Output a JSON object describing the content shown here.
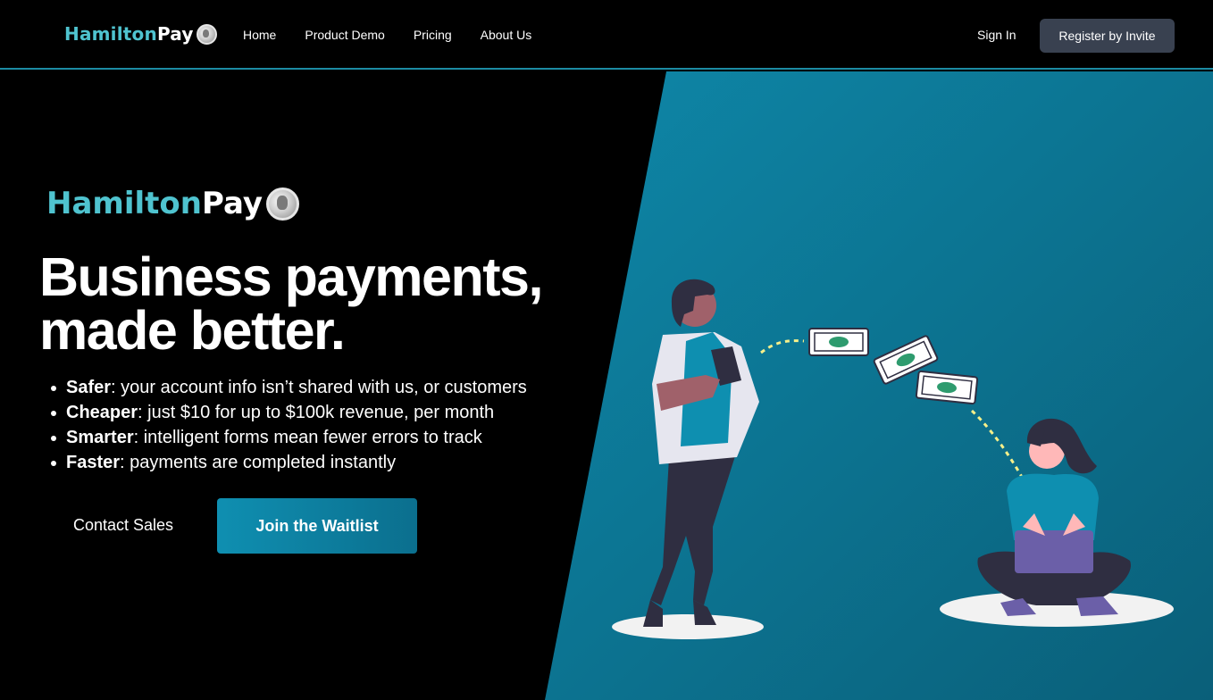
{
  "brand": {
    "name_part1": "Hamilton",
    "name_part2": "Pay"
  },
  "nav": {
    "links": [
      "Home",
      "Product Demo",
      "Pricing",
      "About Us"
    ],
    "sign_in": "Sign In",
    "register": "Register by Invite"
  },
  "hero": {
    "headline_line1": "Business payments,",
    "headline_line2": "made better.",
    "bullets": [
      {
        "bold": "Safer",
        "text": ": your account info isn’t shared with us, or customers"
      },
      {
        "bold": "Cheaper",
        "text": ": just $10 for up to $100k revenue, per month"
      },
      {
        "bold": "Smarter",
        "text": ": intelligent forms mean fewer errors to track"
      },
      {
        "bold": "Faster",
        "text": ": payments are completed instantly"
      }
    ],
    "contact_sales": "Contact Sales",
    "join_waitlist": "Join the Waitlist"
  },
  "colors": {
    "accent": "#4fc3cf",
    "teal_panel": "#0b6f8e",
    "button_dark": "#394150",
    "cta": "#0f8fb1"
  },
  "icons": [
    "coin-logo-icon",
    "cash-bill-icon"
  ]
}
